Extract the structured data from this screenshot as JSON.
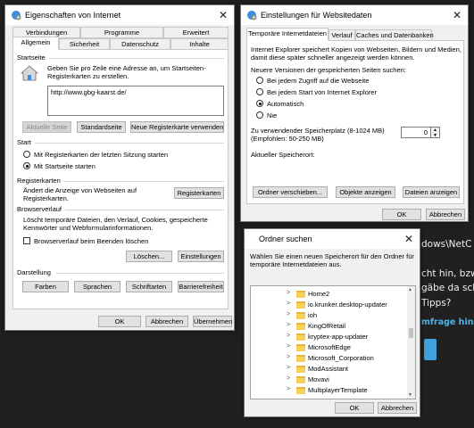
{
  "background": {
    "lines": [
      "dows\\NetC",
      "cht hin, bzw",
      "gäbe da sch",
      "Tipps?"
    ],
    "link": "mfrage hinzu"
  },
  "internet_options": {
    "title": "Eigenschaften von Internet",
    "close": "✕",
    "tabs_row1": [
      "Verbindungen",
      "Programme",
      "Erweitert"
    ],
    "tabs_row2": [
      "Allgemein",
      "Sicherheit",
      "Datenschutz",
      "Inhalte"
    ],
    "startseite": {
      "heading": "Startseite",
      "description": "Geben Sie pro Zeile eine Adresse an, um Startseiten-Registerkarten zu erstellen.",
      "url": "http://www.gbg-kaarst.de/",
      "btn_current": "Aktuelle Seite",
      "btn_default": "Standardseite",
      "btn_newtab": "Neue Registerkarte verwenden"
    },
    "start": {
      "heading": "Start",
      "option_last": "Mit Registerkarten der letzten Sitzung starten",
      "option_home": "Mit Startseite starten",
      "selected": "option_home"
    },
    "registerkarten": {
      "heading": "Registerkarten",
      "description": "Ändert die Anzeige von Webseiten auf Registerkarten.",
      "button": "Registerkarten"
    },
    "browserverlauf": {
      "heading": "Browserverlauf",
      "description": "Löscht temporäre Dateien, den Verlauf, Cookies, gespeicherte Kennwörter und Webformularinformationen.",
      "checkbox": "Browserverlauf beim Beenden löschen",
      "checked": false,
      "btn_delete": "Löschen...",
      "btn_settings": "Einstellungen"
    },
    "darstellung": {
      "heading": "Darstellung",
      "btn_colors": "Farben",
      "btn_languages": "Sprachen",
      "btn_fonts": "Schriftarten",
      "btn_accessibility": "Barrierefreiheit"
    },
    "footer": {
      "ok": "OK",
      "cancel": "Abbrechen",
      "apply": "Übernehmen"
    }
  },
  "website_settings": {
    "title": "Einstellungen für Websitedaten",
    "close": "✕",
    "tabs": [
      "Temporäre Internetdateien",
      "Verlauf",
      "Caches und Datenbanken"
    ],
    "description": "Internet Explorer speichert Kopien von Webseiten, Bildern und Medien, damit diese später schneller angezeigt werden können.",
    "check_prompt": "Neuere Versionen der gespeicherten Seiten suchen:",
    "options": [
      "Bei jedem Zugriff auf die Webseite",
      "Bei jedem Start von Internet Explorer",
      "Automatisch",
      "Nie"
    ],
    "selected_option": "Automatisch",
    "space_label": "Zu verwendender Speicherplatz (8-1024 MB)",
    "space_hint": "(Empfohlen: 50-250 MB)",
    "space_value": "0",
    "current_location": "Aktueller Speicherort:",
    "btn_move": "Ordner verschieben...",
    "btn_objects": "Objekte anzeigen",
    "btn_files": "Dateien anzeigen",
    "footer": {
      "ok": "OK",
      "cancel": "Abbrechen"
    }
  },
  "folder_dialog": {
    "title": "Ordner suchen",
    "close": "✕",
    "instruction": "Wählen Sie einen neuen Speicherort für den Ordner für temporäre Internetdateien aus.",
    "folders": [
      "Home2",
      "io.krunker.desktop-updater",
      "ioh",
      "KingOfRetail",
      "kryptex-app-updater",
      "MicrosoftEdge",
      "Microsoft_Corporation",
      "ModAssistant",
      "Movavi",
      "MultiplayerTemplate"
    ],
    "footer": {
      "ok": "OK",
      "cancel": "Abbrechen"
    }
  },
  "colors": {
    "accent_link": "#4fb3ea",
    "accent_button": "#3ea2df",
    "folder": "#f5cf5a"
  }
}
